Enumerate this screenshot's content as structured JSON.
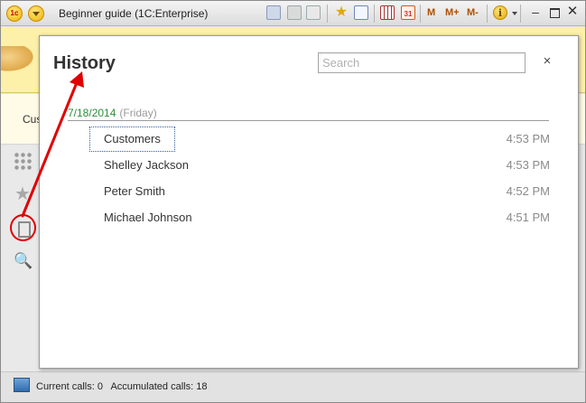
{
  "window": {
    "title": "Beginner guide  (1C:Enterprise)",
    "logo_text": "1c",
    "toolbar": {
      "calendar_day": "31",
      "m_label": "M",
      "m_plus_label": "M+",
      "m_minus_label": "M-",
      "info_label": "i"
    },
    "controls": {
      "minimize": "–",
      "close": "✕"
    }
  },
  "background": {
    "tab_text": "Cus"
  },
  "sidebar": {
    "items": [
      {
        "icon": "apps-grid-icon"
      },
      {
        "icon": "star-icon",
        "glyph": "★"
      },
      {
        "icon": "history-icon"
      },
      {
        "icon": "search-icon",
        "glyph": "🔍"
      }
    ]
  },
  "history": {
    "title": "History",
    "search_placeholder": "Search",
    "close_glyph": "×",
    "date": "7/18/2014",
    "day": "(Friday)",
    "items": [
      {
        "name": "Customers",
        "time": "4:53 PM"
      },
      {
        "name": "Shelley Jackson",
        "time": "4:53 PM"
      },
      {
        "name": "Peter Smith",
        "time": "4:52 PM"
      },
      {
        "name": "Michael Johnson",
        "time": "4:51 PM"
      }
    ]
  },
  "statusbar": {
    "current_calls": "Current calls: 0",
    "accumulated_calls": "Accumulated calls: 18"
  },
  "annotation_color": "#e00000"
}
